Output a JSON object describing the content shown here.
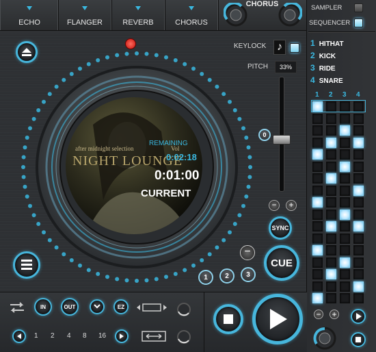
{
  "fx": {
    "echo": "ECHO",
    "flanger": "FLANGER",
    "reverb": "REVERB",
    "chorus": "CHORUS",
    "active_fx_title": "CHORUS"
  },
  "right_panel": {
    "sampler_label": "SAMPLER",
    "sequencer_label": "SEQUENCER",
    "sequencer_checked": true,
    "instruments": [
      {
        "num": "1",
        "name": "HITHAT"
      },
      {
        "num": "2",
        "name": "KICK"
      },
      {
        "num": "3",
        "name": "RIDE"
      },
      {
        "num": "4",
        "name": "SNARE"
      }
    ],
    "columns": [
      "1",
      "2",
      "3",
      "4"
    ],
    "pattern": [
      [
        1,
        0,
        0,
        0
      ],
      [
        0,
        0,
        0,
        0
      ],
      [
        0,
        0,
        1,
        0
      ],
      [
        0,
        1,
        0,
        1
      ],
      [
        1,
        0,
        0,
        0
      ],
      [
        0,
        0,
        1,
        0
      ],
      [
        0,
        1,
        0,
        0
      ],
      [
        0,
        0,
        0,
        1
      ],
      [
        1,
        0,
        0,
        0
      ],
      [
        0,
        0,
        1,
        0
      ],
      [
        0,
        1,
        0,
        1
      ],
      [
        0,
        0,
        0,
        0
      ],
      [
        1,
        0,
        0,
        0
      ],
      [
        0,
        0,
        1,
        0
      ],
      [
        0,
        1,
        0,
        0
      ],
      [
        0,
        0,
        0,
        1
      ],
      [
        1,
        0,
        0,
        0
      ]
    ]
  },
  "deck": {
    "keylock_label": "KEYLOCK",
    "pitch_label": "PITCH",
    "pitch_value": "33%",
    "pitch_zero": "0",
    "pitch_level": 0.45,
    "remaining_label": "REMAINING",
    "remaining_time": "0:02:18",
    "current_time": "0:01:00",
    "current_label": "CURRENT",
    "album_line1": "after midnight selection",
    "album_vol": "Vol",
    "album_title": "NIGHT LOUNGE",
    "sync_label": "SYNC",
    "cue_label": "CUE",
    "hotcues": [
      "1",
      "2",
      "3"
    ]
  },
  "loop": {
    "in_label": "IN",
    "out_label": "OUT",
    "ez_label": "EZ",
    "sizes": [
      "1",
      "2",
      "4",
      "8",
      "16"
    ]
  },
  "colors": {
    "accent": "#3ab8e0",
    "record_marker": "#e0201a"
  },
  "icons": [
    "eject-icon",
    "playlist-icon",
    "loop-icon",
    "play-icon",
    "stop-icon",
    "note-icon"
  ]
}
